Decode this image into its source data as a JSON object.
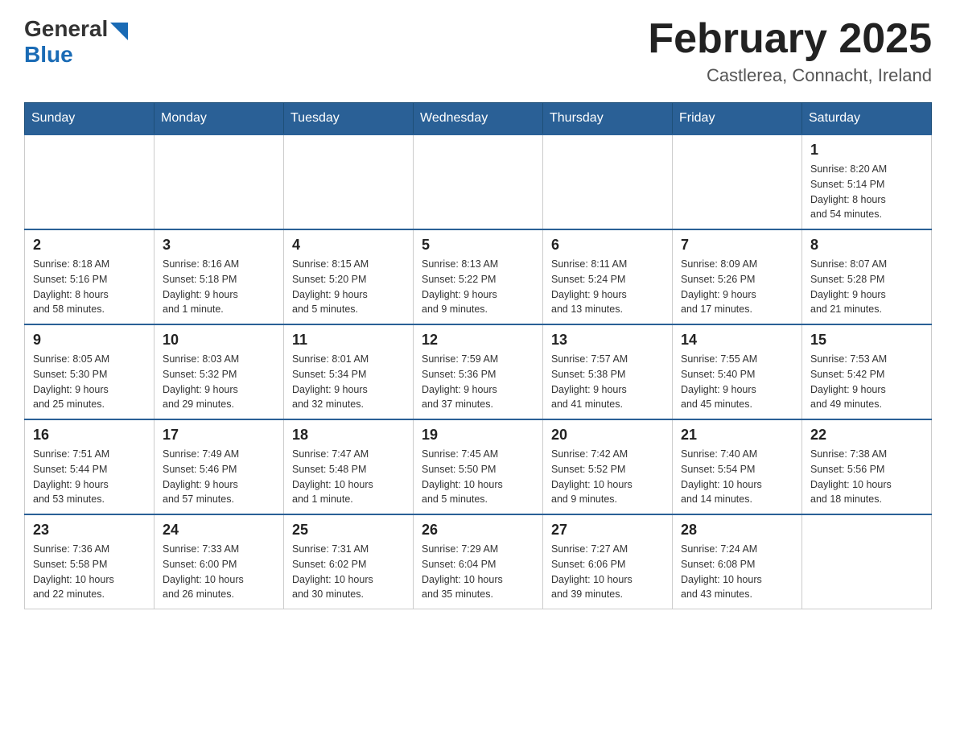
{
  "header": {
    "logo_general": "General",
    "logo_blue": "Blue",
    "month_title": "February 2025",
    "location": "Castlerea, Connacht, Ireland"
  },
  "weekdays": [
    "Sunday",
    "Monday",
    "Tuesday",
    "Wednesday",
    "Thursday",
    "Friday",
    "Saturday"
  ],
  "weeks": [
    {
      "days": [
        {
          "num": "",
          "info": ""
        },
        {
          "num": "",
          "info": ""
        },
        {
          "num": "",
          "info": ""
        },
        {
          "num": "",
          "info": ""
        },
        {
          "num": "",
          "info": ""
        },
        {
          "num": "",
          "info": ""
        },
        {
          "num": "1",
          "info": "Sunrise: 8:20 AM\nSunset: 5:14 PM\nDaylight: 8 hours\nand 54 minutes."
        }
      ]
    },
    {
      "days": [
        {
          "num": "2",
          "info": "Sunrise: 8:18 AM\nSunset: 5:16 PM\nDaylight: 8 hours\nand 58 minutes."
        },
        {
          "num": "3",
          "info": "Sunrise: 8:16 AM\nSunset: 5:18 PM\nDaylight: 9 hours\nand 1 minute."
        },
        {
          "num": "4",
          "info": "Sunrise: 8:15 AM\nSunset: 5:20 PM\nDaylight: 9 hours\nand 5 minutes."
        },
        {
          "num": "5",
          "info": "Sunrise: 8:13 AM\nSunset: 5:22 PM\nDaylight: 9 hours\nand 9 minutes."
        },
        {
          "num": "6",
          "info": "Sunrise: 8:11 AM\nSunset: 5:24 PM\nDaylight: 9 hours\nand 13 minutes."
        },
        {
          "num": "7",
          "info": "Sunrise: 8:09 AM\nSunset: 5:26 PM\nDaylight: 9 hours\nand 17 minutes."
        },
        {
          "num": "8",
          "info": "Sunrise: 8:07 AM\nSunset: 5:28 PM\nDaylight: 9 hours\nand 21 minutes."
        }
      ]
    },
    {
      "days": [
        {
          "num": "9",
          "info": "Sunrise: 8:05 AM\nSunset: 5:30 PM\nDaylight: 9 hours\nand 25 minutes."
        },
        {
          "num": "10",
          "info": "Sunrise: 8:03 AM\nSunset: 5:32 PM\nDaylight: 9 hours\nand 29 minutes."
        },
        {
          "num": "11",
          "info": "Sunrise: 8:01 AM\nSunset: 5:34 PM\nDaylight: 9 hours\nand 32 minutes."
        },
        {
          "num": "12",
          "info": "Sunrise: 7:59 AM\nSunset: 5:36 PM\nDaylight: 9 hours\nand 37 minutes."
        },
        {
          "num": "13",
          "info": "Sunrise: 7:57 AM\nSunset: 5:38 PM\nDaylight: 9 hours\nand 41 minutes."
        },
        {
          "num": "14",
          "info": "Sunrise: 7:55 AM\nSunset: 5:40 PM\nDaylight: 9 hours\nand 45 minutes."
        },
        {
          "num": "15",
          "info": "Sunrise: 7:53 AM\nSunset: 5:42 PM\nDaylight: 9 hours\nand 49 minutes."
        }
      ]
    },
    {
      "days": [
        {
          "num": "16",
          "info": "Sunrise: 7:51 AM\nSunset: 5:44 PM\nDaylight: 9 hours\nand 53 minutes."
        },
        {
          "num": "17",
          "info": "Sunrise: 7:49 AM\nSunset: 5:46 PM\nDaylight: 9 hours\nand 57 minutes."
        },
        {
          "num": "18",
          "info": "Sunrise: 7:47 AM\nSunset: 5:48 PM\nDaylight: 10 hours\nand 1 minute."
        },
        {
          "num": "19",
          "info": "Sunrise: 7:45 AM\nSunset: 5:50 PM\nDaylight: 10 hours\nand 5 minutes."
        },
        {
          "num": "20",
          "info": "Sunrise: 7:42 AM\nSunset: 5:52 PM\nDaylight: 10 hours\nand 9 minutes."
        },
        {
          "num": "21",
          "info": "Sunrise: 7:40 AM\nSunset: 5:54 PM\nDaylight: 10 hours\nand 14 minutes."
        },
        {
          "num": "22",
          "info": "Sunrise: 7:38 AM\nSunset: 5:56 PM\nDaylight: 10 hours\nand 18 minutes."
        }
      ]
    },
    {
      "days": [
        {
          "num": "23",
          "info": "Sunrise: 7:36 AM\nSunset: 5:58 PM\nDaylight: 10 hours\nand 22 minutes."
        },
        {
          "num": "24",
          "info": "Sunrise: 7:33 AM\nSunset: 6:00 PM\nDaylight: 10 hours\nand 26 minutes."
        },
        {
          "num": "25",
          "info": "Sunrise: 7:31 AM\nSunset: 6:02 PM\nDaylight: 10 hours\nand 30 minutes."
        },
        {
          "num": "26",
          "info": "Sunrise: 7:29 AM\nSunset: 6:04 PM\nDaylight: 10 hours\nand 35 minutes."
        },
        {
          "num": "27",
          "info": "Sunrise: 7:27 AM\nSunset: 6:06 PM\nDaylight: 10 hours\nand 39 minutes."
        },
        {
          "num": "28",
          "info": "Sunrise: 7:24 AM\nSunset: 6:08 PM\nDaylight: 10 hours\nand 43 minutes."
        },
        {
          "num": "",
          "info": ""
        }
      ]
    }
  ]
}
